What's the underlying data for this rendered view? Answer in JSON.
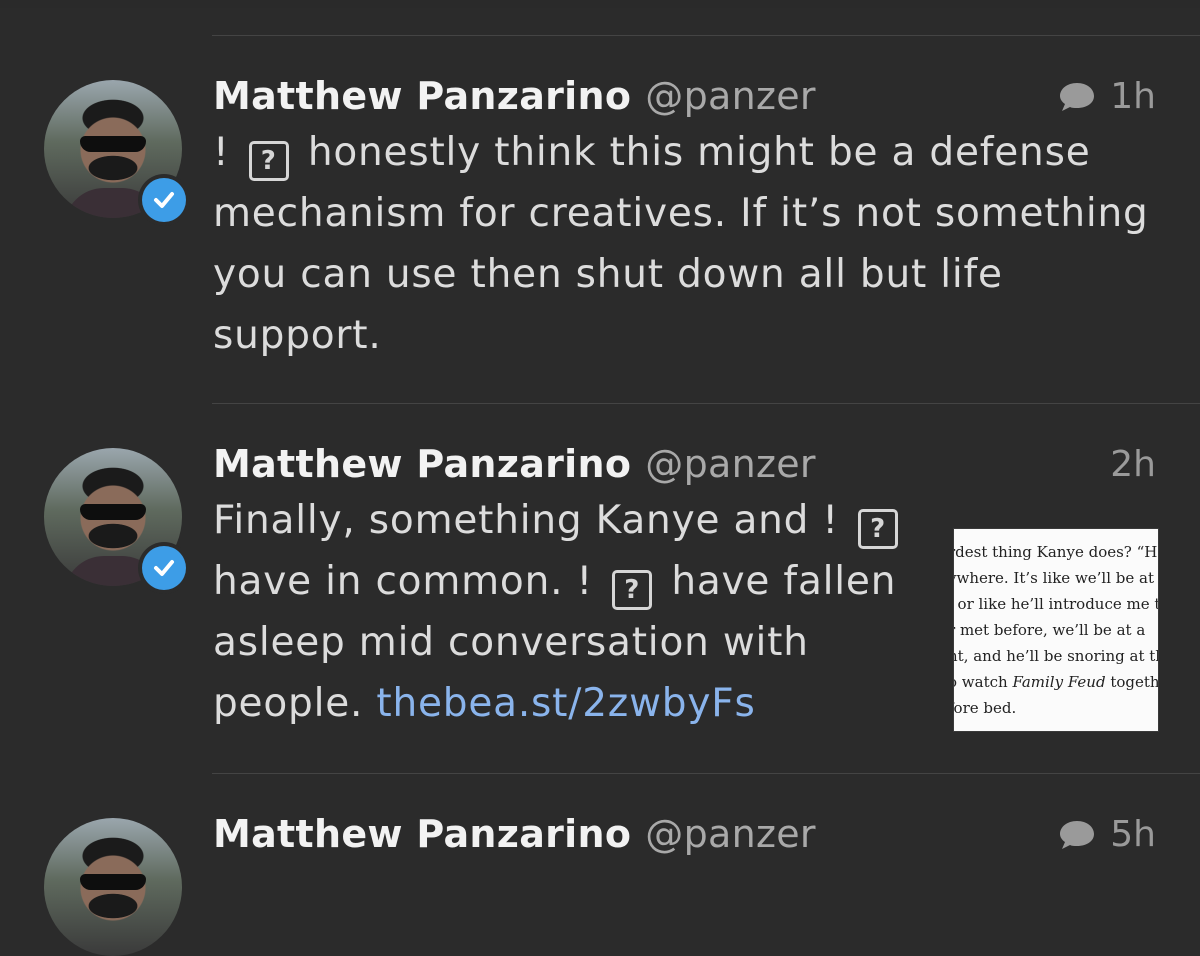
{
  "tweets": [
    {
      "name": "Matthew Panzarino",
      "handle": "@panzer",
      "time": "1h",
      "text_lines": [
        [
          "! ",
          "?",
          " honestly think this might be a defense"
        ],
        [
          "mechanism for creatives. If it’s not something"
        ],
        [
          "you can use then shut down all but life"
        ],
        [
          "support."
        ]
      ]
    },
    {
      "name": "Matthew Panzarino",
      "handle": "@panzer",
      "time": "2h",
      "line1_a": "Finally, something Kanye and ! ",
      "line1_q": "?",
      "line2_a": "have in common. ! ",
      "line2_q": "?",
      "line2_b": " have fallen",
      "line3": "asleep mid conversation with",
      "line4_a": "people. ",
      "line4_link": "thebea.st/2zwbyFs",
      "thumbnail_lines": [
        "rdest thing Kanye does? “He",
        "ywhere. It’s like we’ll be at a",
        ", or like he’ll introduce me to",
        "r met before, we’ll be at a",
        "nt, and he’ll be snoring at th",
        "o watch Family Feud togeth",
        "fore bed."
      ]
    },
    {
      "name": "Matthew Panzarino",
      "handle": "@panzer",
      "time": "5h"
    }
  ],
  "colors": {
    "background": "#2b2b2b",
    "link": "#8ab4ec",
    "verified": "#3d9de7"
  },
  "icons": [
    "reply-bubble-icon",
    "verified-badge-icon",
    "unknown-glyph-icon"
  ]
}
